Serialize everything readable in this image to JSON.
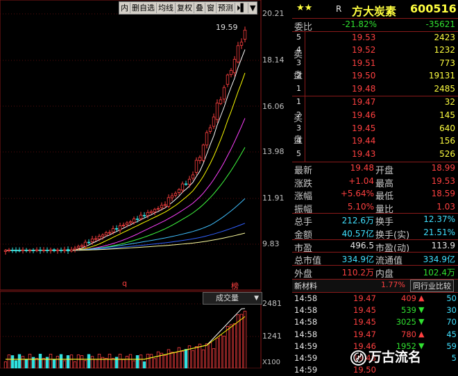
{
  "toolbar": {
    "items": [
      "内",
      "删自选",
      "均线",
      "复权",
      "叠",
      "窗",
      "预测",
      "⏵▌",
      "▼"
    ]
  },
  "price_axis": {
    "labels": [
      "20.21",
      "18.14",
      "16.06",
      "13.98",
      "11.91",
      "9.83"
    ]
  },
  "chart_marks": {
    "high_label": "19.59",
    "marker_q": "q",
    "marker_bang": "榜"
  },
  "volume": {
    "button_label": "成交量",
    "axis_labels": [
      "2481",
      "1241",
      "X100"
    ]
  },
  "stock": {
    "stars": "★★",
    "flag": "R",
    "name": "方大炭素",
    "code": "600516"
  },
  "weibi": {
    "label": "委比",
    "ratio": "-21.82%",
    "diff": "-35621"
  },
  "sell": {
    "side_label": [
      "卖",
      "盘"
    ],
    "rows": [
      {
        "level": "5",
        "price": "19.53",
        "vol": "2423"
      },
      {
        "level": "4",
        "price": "19.52",
        "vol": "1232"
      },
      {
        "level": "3",
        "price": "19.51",
        "vol": "773"
      },
      {
        "level": "2",
        "price": "19.50",
        "vol": "19131"
      },
      {
        "level": "1",
        "price": "19.48",
        "vol": "2485"
      }
    ]
  },
  "buy": {
    "side_label": [
      "买",
      "盘"
    ],
    "rows": [
      {
        "level": "1",
        "price": "19.47",
        "vol": "32"
      },
      {
        "level": "2",
        "price": "19.46",
        "vol": "145"
      },
      {
        "level": "3",
        "price": "19.45",
        "vol": "640"
      },
      {
        "level": "4",
        "price": "19.44",
        "vol": "156"
      },
      {
        "level": "5",
        "price": "19.43",
        "vol": "526"
      }
    ]
  },
  "stats": [
    {
      "l1": "最新",
      "v1": "19.48",
      "c1": "red",
      "l2": "开盘",
      "v2": "18.99",
      "c2": "red"
    },
    {
      "l1": "涨跌",
      "v1": "+1.04",
      "c1": "red",
      "l2": "最高",
      "v2": "19.53",
      "c2": "red"
    },
    {
      "l1": "涨幅",
      "v1": "+5.64%",
      "c1": "red",
      "l2": "最低",
      "v2": "18.59",
      "c2": "red"
    },
    {
      "l1": "振幅",
      "v1": "5.10%",
      "c1": "red",
      "l2": "量比",
      "v2": "1.03",
      "c2": "red"
    },
    {
      "l1": "总手",
      "v1": "212.6万",
      "c1": "cy",
      "l2": "换手",
      "v2": "12.37%",
      "c2": "cy"
    },
    {
      "l1": "金额",
      "v1": "40.57亿",
      "c1": "cy",
      "l2": "换手(实)",
      "v2": "21.51%",
      "c2": "cy"
    },
    {
      "l1": "市盈",
      "v1": "496.5",
      "c1": "wht",
      "l2": "市盈(动)",
      "v2": "113.9",
      "c2": "wht"
    },
    {
      "l1": "总市值",
      "v1": "334.9亿",
      "c1": "cy",
      "l2": "流通值",
      "v2": "334.9亿",
      "c2": "cy"
    },
    {
      "l1": "外盘",
      "v1": "110.2万",
      "c1": "red",
      "l2": "内盘",
      "v2": "102.4万",
      "c2": "grn"
    }
  ],
  "sector": {
    "name": "新材料",
    "change": "1.77%",
    "button": "同行业比较"
  },
  "ticks": [
    {
      "time": "14:58",
      "price": "19.47",
      "vol": "409",
      "dir": "up",
      "n": "50"
    },
    {
      "time": "14:58",
      "price": "19.45",
      "vol": "539",
      "dir": "down",
      "n": "30"
    },
    {
      "time": "14:58",
      "price": "19.45",
      "vol": "3025",
      "dir": "down",
      "n": "70"
    },
    {
      "time": "14:58",
      "price": "19.47",
      "vol": "780",
      "dir": "up",
      "n": "45"
    },
    {
      "time": "14:59",
      "price": "19.46",
      "vol": "1952",
      "dir": "down",
      "n": "59"
    },
    {
      "time": "14:59",
      "price": "19.48",
      "vol": "",
      "dir": "",
      "n": "5"
    },
    {
      "time": "14:59",
      "price": "19.50",
      "vol": "",
      "dir": "",
      "n": ""
    }
  ],
  "watermark": "万古流名",
  "colors": {
    "up": "#ff4040",
    "down": "#30e0e0",
    "grid": "#8b1a1a"
  }
}
